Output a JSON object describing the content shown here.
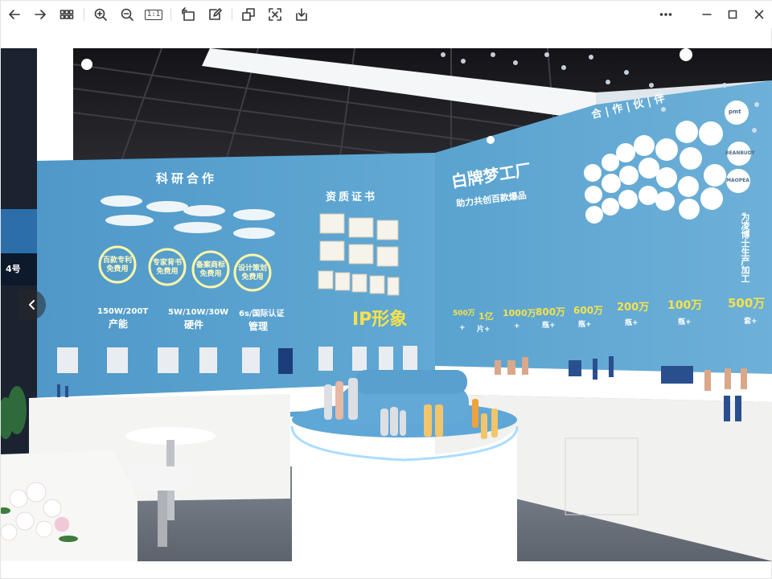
{
  "viewer": {
    "icons": {
      "back": "arrow-left-icon",
      "forward": "arrow-right-icon",
      "thumbnails": "grid-icon",
      "zoom_in": "zoom-in-icon",
      "zoom_out": "zoom-out-icon",
      "actual_size": "actual-size-icon",
      "rotate": "rotate-icon",
      "edit": "edit-icon",
      "copy": "copy-image-icon",
      "ocr": "scan-text-icon",
      "save": "download-icon",
      "more": "more-icon",
      "minimize": "minimize-icon",
      "maximize": "maximize-icon",
      "close": "close-icon",
      "previous": "chevron-left-icon"
    },
    "actual_size_label": "1:1"
  },
  "photo": {
    "left_wall": {
      "heading": "科研合作",
      "badges": [
        "百款专利 免费用",
        "专家背书 免费用",
        "备案商标 免费用",
        "设计策划 免费用"
      ],
      "stats": [
        {
          "value": "150W/200T",
          "label": "产能"
        },
        {
          "value": "5W/10W/30W",
          "label": "硬件"
        },
        {
          "value": "6s/国际认证",
          "label": "管理"
        }
      ]
    },
    "middle_wall": {
      "heading": "资质证书",
      "ip_label": "IP形象"
    },
    "right_wall": {
      "brand": "白牌梦工厂",
      "slogan": "助力共创百款爆品",
      "partners_heading": "合 | 作 | 伙 | 伴",
      "partner_logos": [
        "BEANBUDY",
        "MAOPEA",
        "pmt"
      ],
      "capacities": [
        {
          "value": "500万",
          "unit": "+"
        },
        {
          "value": "1亿",
          "unit": "片+"
        },
        {
          "value": "1000万",
          "unit": "+"
        },
        {
          "value": "800万",
          "unit": "瓶+"
        },
        {
          "value": "600万",
          "unit": "瓶+"
        },
        {
          "value": "200万",
          "unit": "瓶+"
        },
        {
          "value": "100万",
          "unit": "瓶+"
        },
        {
          "value": "500万",
          "unit": "套+"
        }
      ],
      "last_caption": "为凌博士生产加工"
    },
    "sign": "4号"
  },
  "colors": {
    "wall": "#5aa3cf",
    "ceiling": "#1e1e22",
    "counter": "#f4f4f2",
    "accent_yellow": "#f6e24a",
    "toolbar_icon": "#3a3a3a"
  }
}
